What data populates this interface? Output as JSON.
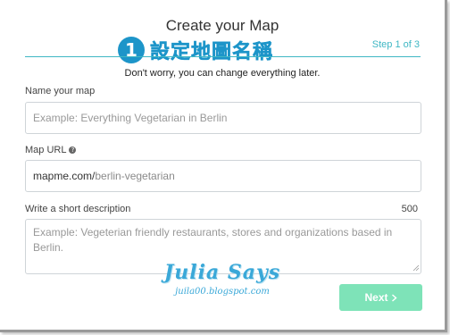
{
  "header": {
    "title": "Create your Map",
    "step": "Step 1 of 3",
    "subtitle": "Don't worry, you can change everything later."
  },
  "overlay": {
    "number": "1",
    "text": "設定地圖名稱"
  },
  "form": {
    "name": {
      "label": "Name your map",
      "placeholder": "Example: Everything Vegetarian in Berlin"
    },
    "url": {
      "label": "Map URL",
      "help_icon": "question-circle-icon",
      "prefix": "mapme.com/",
      "slug": "berlin-vegetarian"
    },
    "description": {
      "label": "Write a short description",
      "counter": "500",
      "placeholder": "Example: Vegeterian friendly restaurants, stores and organizations based in Berlin."
    }
  },
  "watermark": {
    "title": "Julia Says",
    "url": "juila00.blogspot.com"
  },
  "next_button": {
    "label": "Next",
    "icon": "chevron-right-icon"
  },
  "colors": {
    "accent": "#3fb7c4",
    "overlay_blue": "#1d95c9",
    "button": "#7ee3b8"
  }
}
